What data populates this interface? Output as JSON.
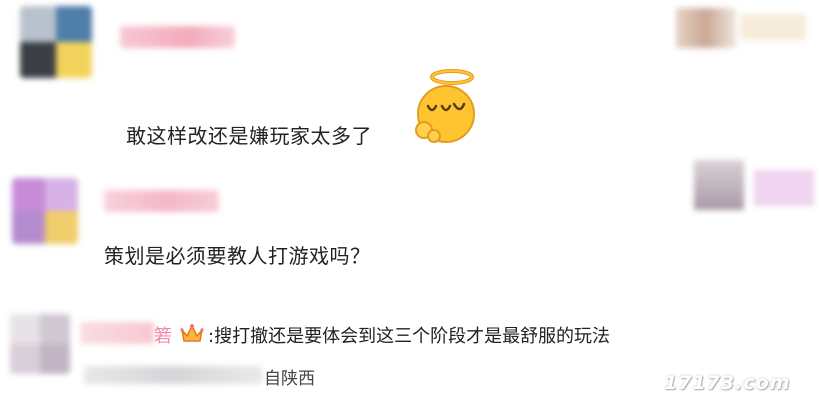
{
  "comments": [
    {
      "text": "敢这样改还是嫌玩家太多了",
      "emoji": "angel-face-emoji"
    },
    {
      "text": "策划是必须要教人打游戏吗？"
    },
    {
      "text": ":搜打撤还是要体会到这三个阶段才是最舒服的玩法",
      "name_tail": "箬",
      "badge": "crown-badge",
      "location": "自陕西"
    }
  ],
  "watermark": "17173.com",
  "colors": {
    "name_pink": "#f3a7b8",
    "emoji_yellow": "#ffc531",
    "emoji_outline": "#e59b1f"
  }
}
